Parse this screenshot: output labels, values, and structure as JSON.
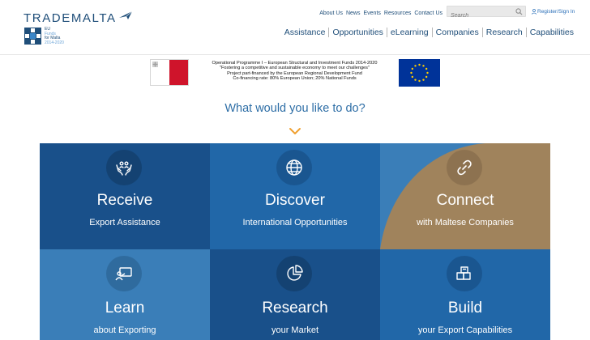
{
  "header": {
    "logo_text": "TRADEMALTA",
    "eu_funds": {
      "line1": "EU",
      "line2": "Funds",
      "line3": "for Malta",
      "line4": "2014-2020"
    },
    "top_links": [
      "About Us",
      "News",
      "Events",
      "Resources",
      "Contact Us"
    ],
    "search": {
      "placeholder": "Search"
    },
    "register_label": "Register/Sign In",
    "main_nav": [
      "Assistance",
      "Opportunities",
      "eLearning",
      "Companies",
      "Research",
      "Capabilities"
    ]
  },
  "banner": {
    "lines": [
      "Operational Programme I – European Structural and Investment Funds 2014-2020",
      "\"Fostering a competitive and sustainable economy to meet our challenges\"",
      "Project part-financed by the European Regional Development Fund",
      "Co-financing rate: 80% European Union; 20% National Funds"
    ]
  },
  "question": "What would you like to do?",
  "tiles": [
    {
      "title": "Receive",
      "subtitle": "Export Assistance",
      "icon": "hands-people-icon",
      "bg": "#19508a",
      "circle": "#144272"
    },
    {
      "title": "Discover",
      "subtitle": "International Opportunities",
      "icon": "globe-icon",
      "bg": "#2167a8",
      "circle": "#1a5690"
    },
    {
      "title": "Connect",
      "subtitle": "with Maltese Companies",
      "icon": "link-icon",
      "bg": "#a0835c",
      "circle": "#8d7250"
    },
    {
      "title": "Learn",
      "subtitle": "about Exporting",
      "icon": "presentation-board-icon",
      "bg": "#3a7eb8",
      "circle": "#2f6b9e"
    },
    {
      "title": "Research",
      "subtitle": "your Market",
      "icon": "pie-chart-icon",
      "bg": "#19508a",
      "circle": "#144272"
    },
    {
      "title": "Build",
      "subtitle": "your Export Capabilities",
      "icon": "boxes-icon",
      "bg": "#2167a8",
      "circle": "#1a5690"
    }
  ],
  "colors": {
    "brand": "#1f4e79",
    "accent_chevron": "#f0a030",
    "link": "#2a6fb8"
  }
}
